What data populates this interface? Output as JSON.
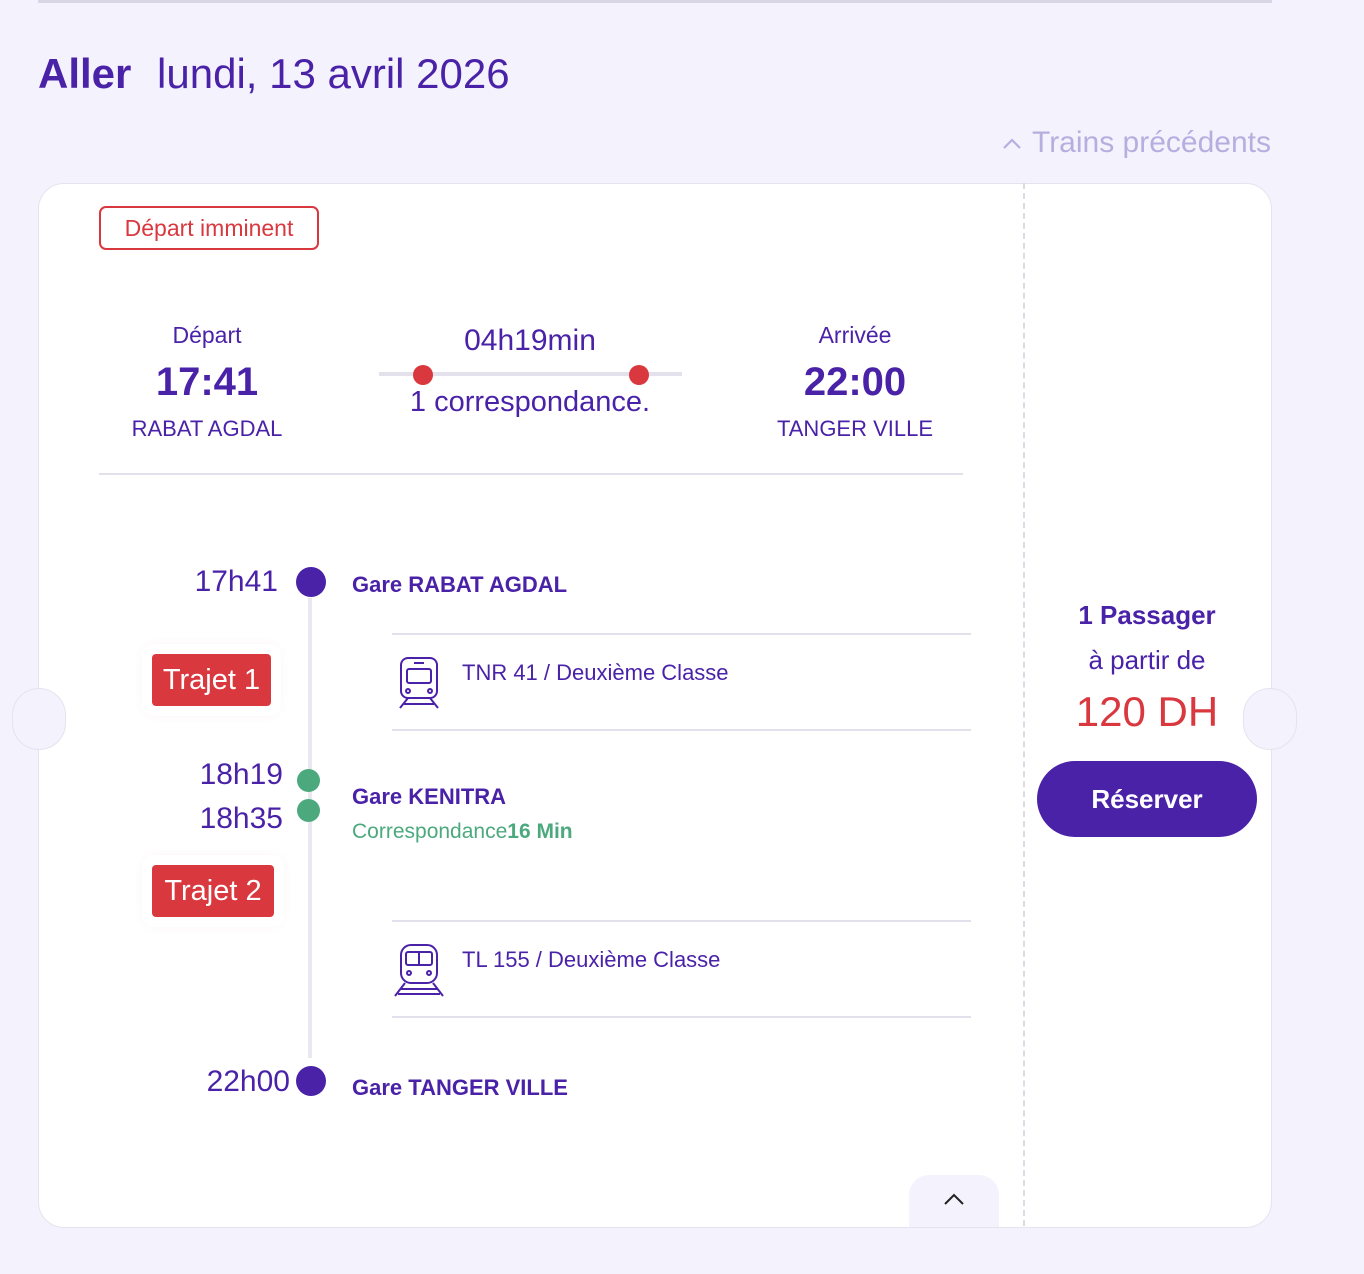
{
  "heading": {
    "direction": "Aller",
    "date": "lundi, 13 avril 2026"
  },
  "prev_trains": {
    "icon": "chevron-up-icon",
    "label": "Trains précédents"
  },
  "badge": "Départ imminent",
  "summary": {
    "departure_label": "Départ",
    "departure_time": "17:41",
    "departure_station": "RABAT AGDAL",
    "duration": "04h19min",
    "connections": "1 correspondance.",
    "arrival_label": "Arrivée",
    "arrival_time": "22:00",
    "arrival_station": "TANGER VILLE"
  },
  "timeline": {
    "stop1": {
      "time": "17h41",
      "station": "Gare RABAT AGDAL"
    },
    "leg1": {
      "label": "Trajet 1",
      "train": "TNR 41 / Deuxième Classe",
      "icon": "train-icon"
    },
    "stop2": {
      "arr_time": "18h19",
      "dep_time": "18h35",
      "station": "Gare KENITRA",
      "corr_label": "Correspondance",
      "corr_duration": "16 Min"
    },
    "leg2": {
      "label": "Trajet 2",
      "train": "TL 155 / Deuxième Classe",
      "icon": "train-icon"
    },
    "stop3": {
      "time": "22h00",
      "station": "Gare TANGER VILLE"
    }
  },
  "pricing": {
    "passengers": "1 Passager",
    "from_label": "à partir de",
    "price": "120 DH",
    "button": "Réserver"
  },
  "collapse_icon": "chevron-up-icon",
  "colors": {
    "primary": "#4a22a8",
    "red": "#d9383f",
    "green": "#4ca97e",
    "background": "#f4f2fc"
  }
}
